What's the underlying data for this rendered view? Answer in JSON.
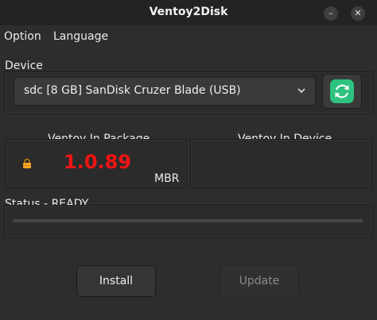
{
  "window": {
    "title": "Ventoy2Disk"
  },
  "menu": {
    "option": "Option",
    "language": "Language"
  },
  "device": {
    "label": "Device",
    "selected": "sdc  [8 GB]  SanDisk Cruzer Blade (USB)"
  },
  "package": {
    "label": "Ventoy In Package",
    "version": "1.0.89",
    "partition_style": "MBR"
  },
  "device_version": {
    "label": "Ventoy In Device"
  },
  "status": {
    "label": "Status - READY",
    "progress": 0
  },
  "buttons": {
    "install": "Install",
    "update": "Update"
  },
  "colors": {
    "version": "#f01414",
    "refresh": "#2ec27e",
    "lock": "#f5a623"
  }
}
